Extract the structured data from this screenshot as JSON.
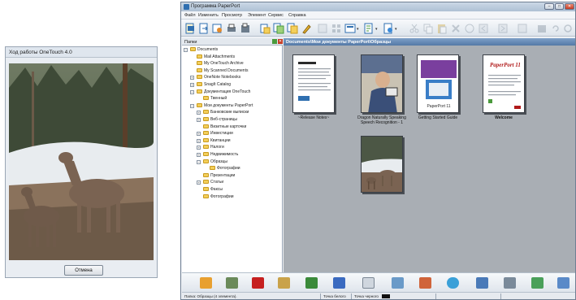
{
  "onetouch": {
    "title": "Ход работы OneTouch 4.0",
    "cancel_label": "Отмена"
  },
  "paperport": {
    "title": "Программа PaperPort",
    "window_buttons": [
      "–",
      "□",
      "✕"
    ],
    "menu": [
      "Файл",
      "Изменить",
      "Просмотр",
      "Элемент",
      "Сервис",
      "Справка"
    ],
    "folders_header": "Папки",
    "folders_close": "✕",
    "path": "Documents\\Мои документы PaperPort\\Образцы",
    "tree": [
      {
        "label": "Documents",
        "expander": "−"
      },
      {
        "label": "Mail Attachments",
        "expander": ""
      },
      {
        "label": "My OneTouch Archive",
        "expander": ""
      },
      {
        "label": "My Scanned Documents",
        "expander": ""
      },
      {
        "label": "OneNote Notebooks",
        "expander": "+"
      },
      {
        "label": "SnagIt Catalog",
        "expander": "+"
      },
      {
        "label": "Документация OneTouch",
        "expander": "−"
      },
      {
        "label": "Твенный",
        "expander": ""
      },
      {
        "label": "Мои документы PaperPort",
        "expander": "−"
      },
      {
        "label": "Банковские выписки",
        "expander": "+"
      },
      {
        "label": "Веб-страницы",
        "expander": "+"
      },
      {
        "label": "Визитные карточки",
        "expander": ""
      },
      {
        "label": "Инвестиции",
        "expander": "+"
      },
      {
        "label": "Квитанции",
        "expander": "+"
      },
      {
        "label": "Налоги",
        "expander": "+"
      },
      {
        "label": "Недвижимость",
        "expander": "+"
      },
      {
        "label": "Образцы",
        "expander": "−"
      },
      {
        "label": "Фотографии",
        "expander": ""
      },
      {
        "label": "Презентации",
        "expander": ""
      },
      {
        "label": "Статьи",
        "expander": "+"
      },
      {
        "label": "Факсы",
        "expander": ""
      },
      {
        "label": "Фотографии",
        "expander": ""
      }
    ],
    "thumbnails": [
      {
        "label": "~Release Notes~"
      },
      {
        "label": "Dragon Naturally Speaking Speech Recognition - 1"
      },
      {
        "label": "Getting Started Guide"
      },
      {
        "label": "Welcome"
      },
      {
        "label": ""
      }
    ],
    "thumb_texts": {
      "getting_started": "PaperPort 11",
      "welcome": "PaperPort 11"
    },
    "status": {
      "left": "Папка: Образцы (4 элемента).",
      "mid": "Точка белого",
      "right": "Точка черного"
    },
    "colors": {
      "title_bar": "#aec0d4",
      "content_bg": "#a9aeb4",
      "path_bar": "#5479a6",
      "folder": "#f3cf5b"
    },
    "icons": {
      "toolbar": [
        "scan-icon",
        "get-items-icon",
        "acquire-icon",
        "print-icon",
        "fax-icon",
        "new-stack-icon",
        "stack-icon",
        "unstack-icon",
        "annotate-icon",
        "page-view-icon",
        "thumbnail-view-icon",
        "view-dropdown-icon",
        "properties-dropdown-icon",
        "sort-dropdown-icon",
        "cut-icon",
        "copy-icon",
        "paste-icon",
        "delete-icon",
        "info-icon",
        "back-icon",
        "forward-icon",
        "zoom-icon",
        "rotate-icon"
      ],
      "send_to": [
        "image-editor-icon",
        "scanner-icon",
        "acrobat-icon",
        "ocr-icon",
        "spreadsheet-icon",
        "word-icon",
        "notepad-icon",
        "email-icon",
        "presentation-icon",
        "web-icon",
        "screenshot-icon",
        "printer-icon",
        "archive-icon",
        "network-icon"
      ]
    }
  }
}
